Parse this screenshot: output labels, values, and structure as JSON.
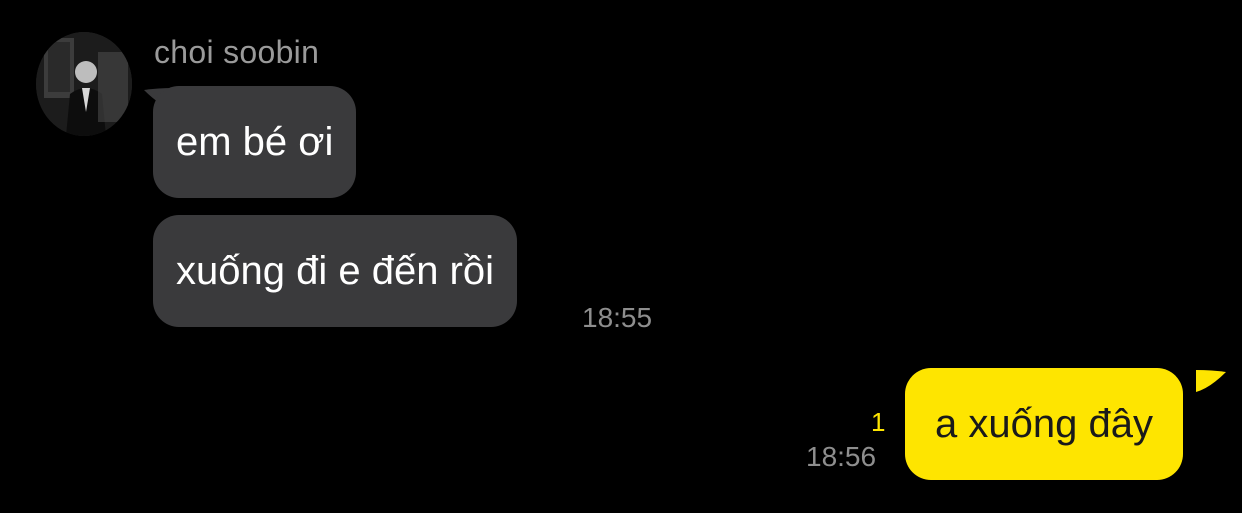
{
  "sender": {
    "name": "choi soobin"
  },
  "messages": [
    {
      "direction": "incoming",
      "text": "em bé ơi"
    },
    {
      "direction": "incoming",
      "text": "xuống đi e đến rồi",
      "time": "18:55"
    },
    {
      "direction": "outgoing",
      "text": "a xuống đây",
      "time": "18:56",
      "unread_count": "1"
    }
  ],
  "colors": {
    "background": "#000000",
    "incoming_bubble": "#3a3a3c",
    "outgoing_bubble": "#fee500",
    "unread_indicator": "#fee500",
    "timestamp": "#8e8e8e",
    "sender_name": "#9a9a9a"
  }
}
